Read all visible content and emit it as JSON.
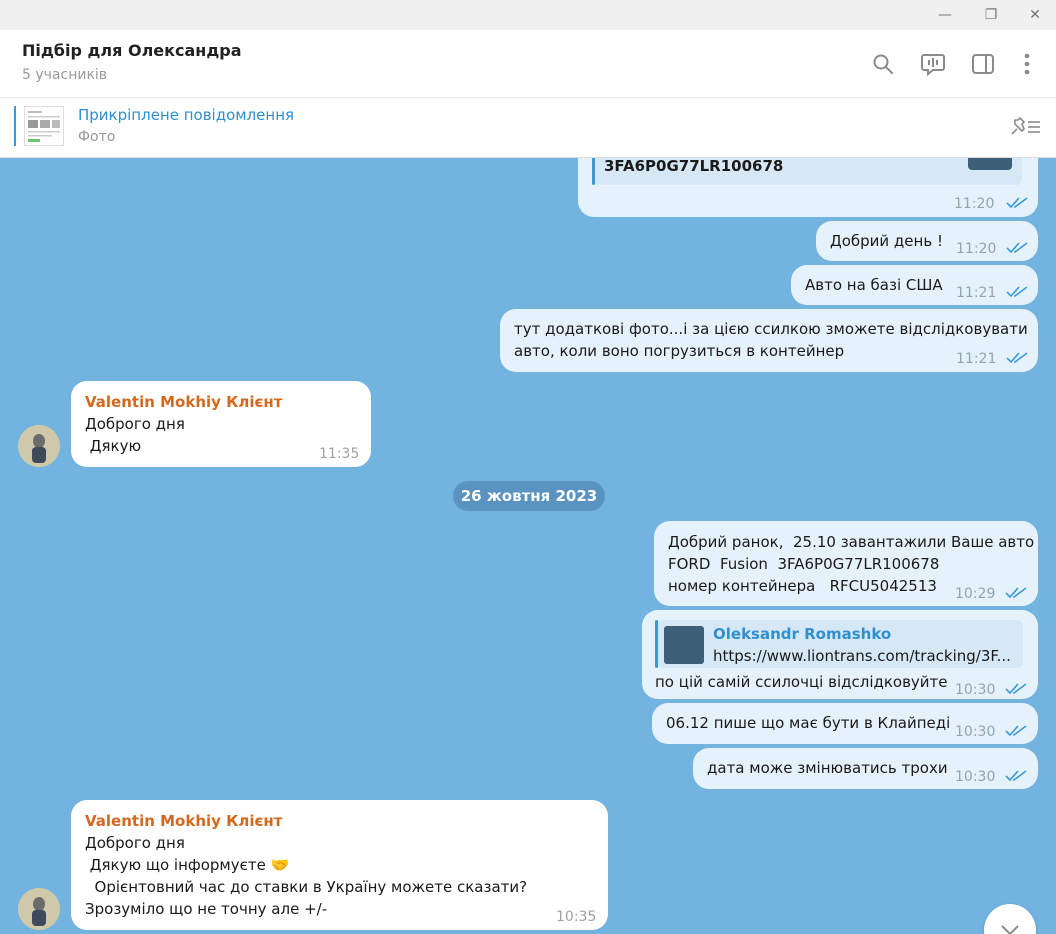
{
  "window": {
    "minimize_glyph": "—",
    "restore_glyph": "❐",
    "close_glyph": "✕"
  },
  "header": {
    "title": "Підбір для Олександра",
    "subtitle": "5 учасників",
    "icons": [
      "search-icon",
      "voice-chat-icon",
      "sidebar-toggle-icon",
      "more-vert-icon"
    ]
  },
  "pinned": {
    "title": "Прикріплене повідомлення",
    "subtitle": "Фото"
  },
  "messages": {
    "m0": {
      "text": "3FA6P0G77LR100678",
      "time": "11:20"
    },
    "m1": {
      "text": "Добрий день !",
      "time": "11:20"
    },
    "m2": {
      "text": "Авто на базі США",
      "time": "11:21"
    },
    "m3": {
      "line1": "тут додаткові фото...і за цією ссилкою зможете відслідковувати",
      "line2": "авто, коли воно погрузиться в контейнер",
      "time": "11:21"
    },
    "m4": {
      "sender": "Valentin Mokhiy Клієнт",
      "line1": "Доброго дня",
      "line2": " Дякую",
      "time": "11:35"
    },
    "date": "26 жовтня 2023",
    "m5": {
      "line1": "Добрий ранок,  25.10 завантажили Ваше авто",
      "line2": "FORD  Fusion  3FA6P0G77LR100678",
      "line3": "номер контейнера   RFCU5042513",
      "time": "10:29"
    },
    "m6": {
      "reply_name": "Oleksandr Romashko",
      "reply_link": "https://www.liontrans.com/tracking/3F...",
      "text": "по цій самій ссилочці відслідковуйте",
      "time": "10:30"
    },
    "m7": {
      "text": "06.12 пише що має бути в Клайпеді",
      "time": "10:30"
    },
    "m8": {
      "text": "дата може змінюватись трохи",
      "time": "10:30"
    },
    "m9": {
      "sender": "Valentin Mokhiy Клієнт",
      "line1": "Доброго дня",
      "line2": " Дякую що інформуєте 🤝",
      "line3": "  Орієнтовний час до ставки в Україну можете сказати?",
      "line4": "Зрозуміло що не точну але +/-",
      "time": "10:35"
    }
  },
  "colors": {
    "chat_background": "#72b3e0",
    "outgoing_bubble": "#e6f2fb",
    "incoming_bubble": "#ffffff",
    "sender_name": "#d2691e",
    "link_accent": "#2f8fd0",
    "date_pill": "#5a93c0"
  }
}
